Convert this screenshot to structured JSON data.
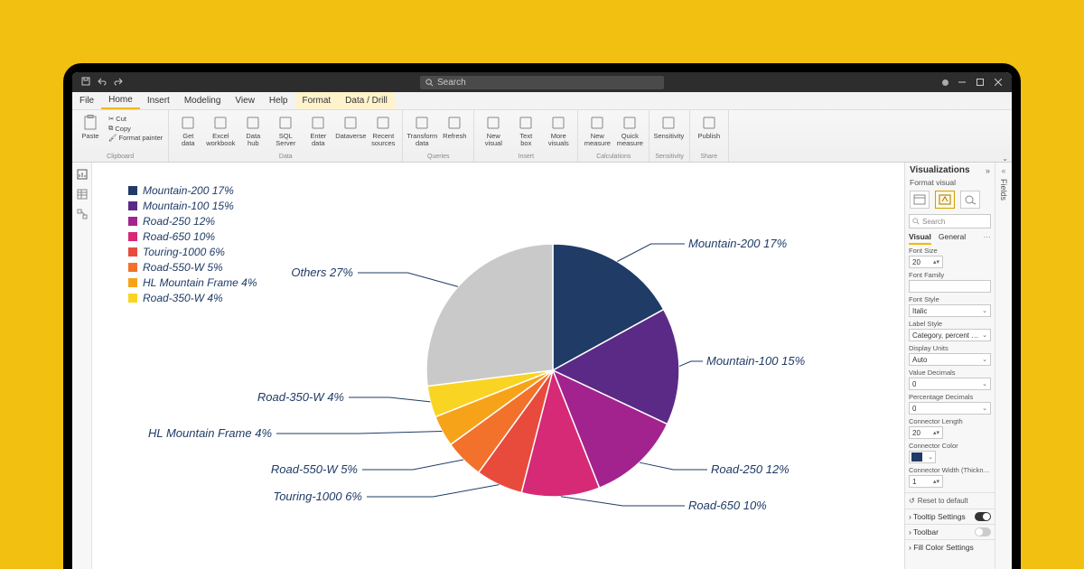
{
  "colors": {
    "accent": "#f2b900",
    "navy": "#1f3b66"
  },
  "titlebar": {
    "search_placeholder": "Search"
  },
  "menu": {
    "items": [
      "File",
      "Home",
      "Insert",
      "Modeling",
      "View",
      "Help",
      "Format",
      "Data / Drill"
    ],
    "active": "Home",
    "gold_from": 6
  },
  "ribbon": {
    "paste": {
      "label": "Paste",
      "cut": "Cut",
      "copy": "Copy",
      "fmt": "Format painter",
      "group": "Clipboard"
    },
    "data": {
      "group": "Data",
      "items": [
        "Get data",
        "Excel workbook",
        "Data hub",
        "SQL Server",
        "Enter data",
        "Dataverse",
        "Recent sources"
      ]
    },
    "queries": {
      "group": "Queries",
      "items": [
        "Transform data",
        "Refresh"
      ]
    },
    "insert": {
      "group": "Insert",
      "items": [
        "New visual",
        "Text box",
        "More visuals"
      ]
    },
    "calc": {
      "group": "Calculations",
      "items": [
        "New measure",
        "Quick measure"
      ]
    },
    "sens": {
      "group": "Sensitivity",
      "items": [
        "Sensitivity"
      ]
    },
    "share": {
      "group": "Share",
      "items": [
        "Publish"
      ]
    }
  },
  "chart_data": {
    "type": "pie",
    "title": "",
    "slices": [
      {
        "name": "Mountain-200",
        "percent": 17,
        "color": "#1f3b66"
      },
      {
        "name": "Mountain-100",
        "percent": 15,
        "color": "#5b2a86"
      },
      {
        "name": "Road-250",
        "percent": 12,
        "color": "#a3238e"
      },
      {
        "name": "Road-650",
        "percent": 10,
        "color": "#d62976"
      },
      {
        "name": "Touring-1000",
        "percent": 6,
        "color": "#e84b3c"
      },
      {
        "name": "Road-550-W",
        "percent": 5,
        "color": "#f2722c"
      },
      {
        "name": "HL Mountain Frame",
        "percent": 4,
        "color": "#f7a31a"
      },
      {
        "name": "Road-350-W",
        "percent": 4,
        "color": "#f9d423"
      },
      {
        "name": "Others",
        "percent": 27,
        "color": "#c9c9c9"
      }
    ],
    "data_label_format": "{name} {percent}%"
  },
  "vis": {
    "title": "Visualizations",
    "subtitle": "Format visual",
    "search_placeholder": "Search",
    "tabs": {
      "visual": "Visual",
      "general": "General"
    },
    "fields": {
      "font_size": {
        "label": "Font Size",
        "value": "20"
      },
      "font_family": {
        "label": "Font Family",
        "value": ""
      },
      "font_style": {
        "label": "Font Style",
        "value": "Italic"
      },
      "label_style": {
        "label": "Label Style",
        "value": "Category, percent of to"
      },
      "display_units": {
        "label": "Display Units",
        "value": "Auto"
      },
      "value_decimals": {
        "label": "Value Decimals",
        "value": "0"
      },
      "pct_decimals": {
        "label": "Percentage Decimals",
        "value": "0"
      },
      "connector_length": {
        "label": "Connector Length",
        "value": "20"
      },
      "connector_color": {
        "label": "Connector Color",
        "value": "#1f3b66"
      },
      "connector_width": {
        "label": "Connector Width (Thickn…",
        "value": "1"
      }
    },
    "reset": "Reset to default",
    "tooltip": "Tooltip Settings",
    "toolbar": "Toolbar",
    "fill_color": "Fill Color Settings"
  },
  "fields_rail": {
    "label": "Fields"
  }
}
